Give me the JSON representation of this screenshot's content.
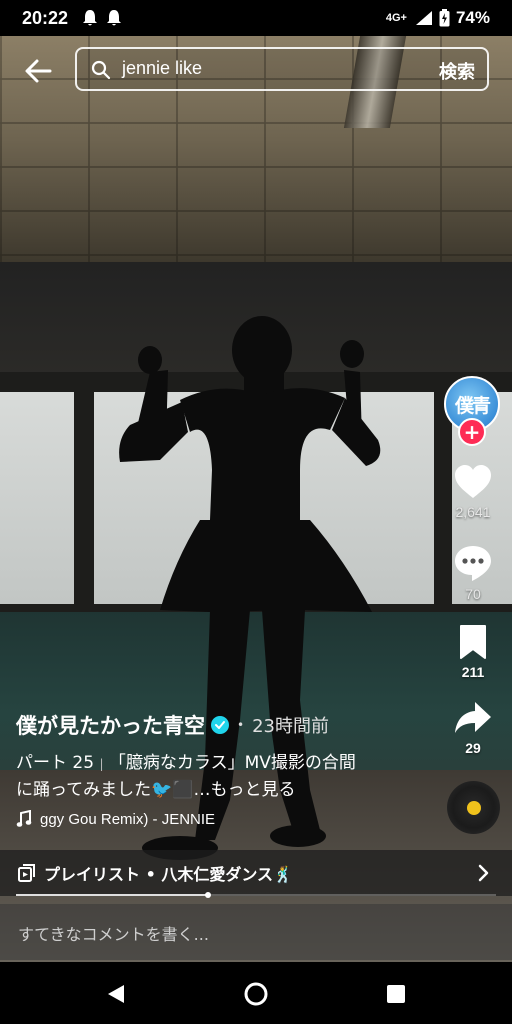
{
  "status_bar": {
    "time": "20:22",
    "network": "4G+",
    "battery": "74%"
  },
  "search": {
    "query": "jennie like",
    "submit_label": "検索"
  },
  "video": {
    "author": "僕が見たかった青空",
    "time_ago": "23時間前",
    "description_line1_part": "パート 25",
    "description_line1_rest": "「臆病なカラス」MV撮影の合間",
    "description_line2": "に踊ってみました🐦⬛…",
    "more_label": "もっと見る",
    "music": "ɡgy Gou Remix) - JENNIE",
    "playback_progress": 0.4
  },
  "avatar": {
    "text": "僕青"
  },
  "actions": {
    "likes": "2,641",
    "comments": "70",
    "saves": "211",
    "shares": "29"
  },
  "playlist": {
    "label": "プレイリスト • 八木仁愛ダンス🕺"
  },
  "comment": {
    "placeholder": "すてきなコメントを書く..."
  },
  "colors": {
    "follow": "#fe2c55",
    "verified": "#20d5ec",
    "disc_center": "#f0c21c",
    "avatar": "#3b8fd8"
  }
}
